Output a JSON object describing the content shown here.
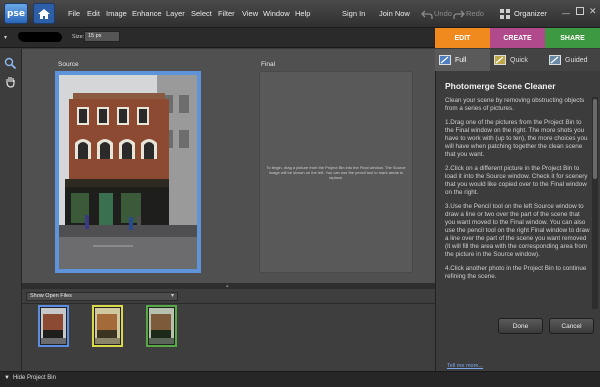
{
  "app": {
    "logo_text": "pse"
  },
  "menu": {
    "items": [
      "File",
      "Edit",
      "Image",
      "Enhance",
      "Layer",
      "Select",
      "Filter",
      "View",
      "Window",
      "Help"
    ],
    "sign_in": "Sign In",
    "join_now": "Join Now",
    "undo": "Undo",
    "redo": "Redo",
    "organizer": "Organizer"
  },
  "options": {
    "size_label": "Size:",
    "size_value": "15 px"
  },
  "mode_tabs": [
    {
      "label": "EDIT",
      "color": "#f08a1e"
    },
    {
      "label": "CREATE",
      "color": "#b04a8c"
    },
    {
      "label": "SHARE",
      "color": "#3e9a42"
    }
  ],
  "edit_tabs": [
    {
      "label": "Full",
      "active": true
    },
    {
      "label": "Quick",
      "active": false
    },
    {
      "label": "Guided",
      "active": false
    }
  ],
  "work": {
    "source_label": "Source",
    "final_label": "Final",
    "final_hint": "To begin, drag a picture from the Project Bin into the Final window. The Source image will be shown on the left. You can use the pencil tool to mark areas to replace."
  },
  "bin": {
    "dropdown": "Show Open Files",
    "thumbnail_border_colors": [
      "#5a8ee0",
      "#d8d848",
      "#58a848"
    ]
  },
  "panel": {
    "title": "Photomerge Scene Cleaner",
    "paragraphs": [
      "Clean your scene by removing obstructing objects from a series of pictures.",
      "1.Drag one of the pictures from the Project Bin to the Final window on the right. The more shots you have to work with (up to ten), the more choices you will have when patching together the clean scene that you want.",
      "2.Click on a different picture in the Project Bin to load it into the Source window. Check it for scenery that you would like copied over to the Final window on the right.",
      "3.Use the Pencil tool on the left Source window to draw a line or two over the part of the scene that you want moved to the Final window. You can also use the pencil tool on the right Final window to draw a line over the part of the scene you want removed (it will fill the area with the corresponding area from the picture in the Source window).",
      "4.Click another photo in the Project Bin to continue refining the scene."
    ],
    "done": "Done",
    "cancel": "Cancel",
    "tell_me_more": "Tell me more..."
  },
  "status": {
    "hide_bin": "Hide Project Bin"
  }
}
